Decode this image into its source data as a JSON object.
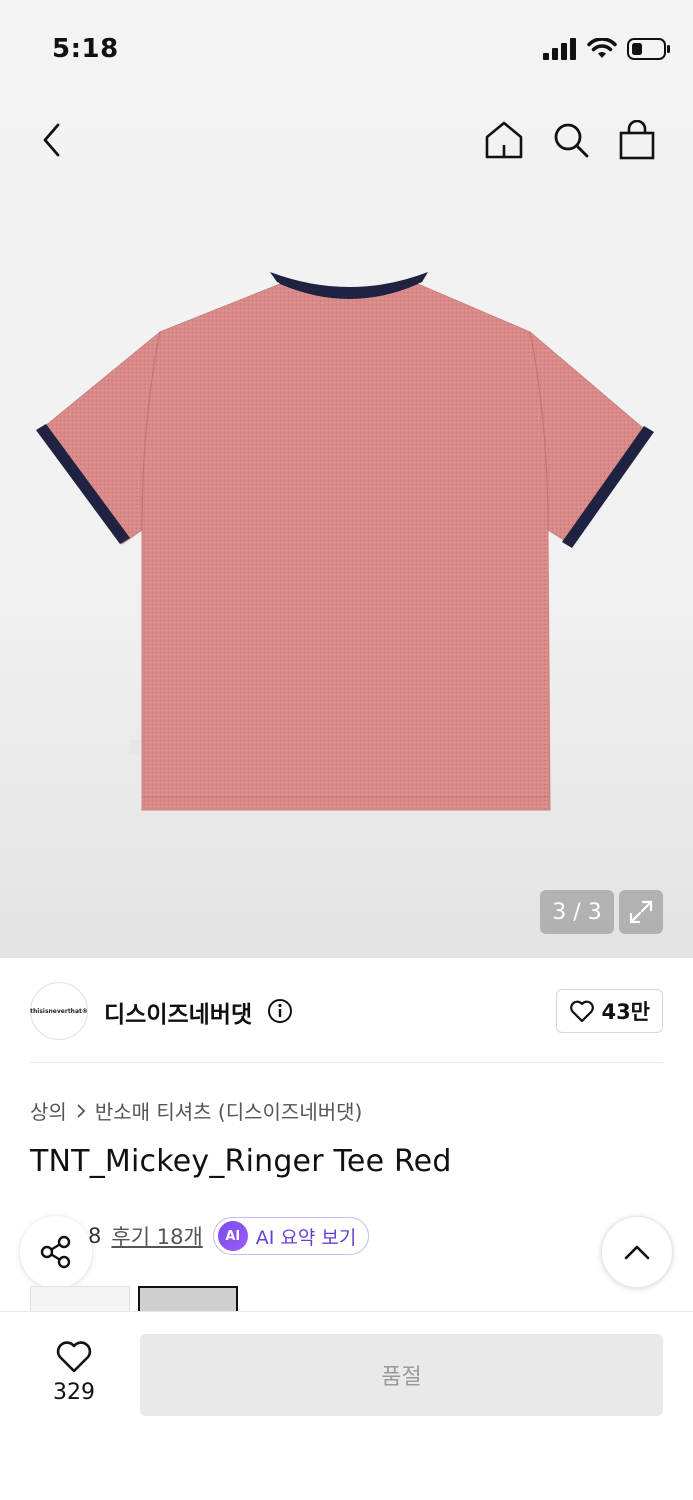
{
  "status_bar": {
    "time": "5:18",
    "icons": [
      "signal-icon",
      "wifi-icon",
      "battery-icon"
    ]
  },
  "nav": {
    "back_icon": "back-icon",
    "home_icon": "home-icon",
    "search_icon": "search-icon",
    "cart_icon": "shopping-bag-icon"
  },
  "gallery": {
    "counter": "3 / 3",
    "expand_icon": "expand-icon",
    "image": "pink-ringer-tee-back"
  },
  "brand": {
    "logo_text": "thisisneverthat®",
    "name": "디스이즈네버댓",
    "likes": "43만"
  },
  "breadcrumb": {
    "category": "상의",
    "subcategory": "반소매 티셔츠 (디스이즈네버댓)"
  },
  "product": {
    "title": "TNT_Mickey_Ringer Tee Red"
  },
  "rating": {
    "score": "4.8",
    "reviews": "후기 18개",
    "ai_badge": "AI",
    "ai_label": "AI 요약 보기"
  },
  "bottom": {
    "wish_count": "329",
    "soldout_label": "품절"
  },
  "colors": {
    "shirt": "#d88a8a",
    "trim": "#1f2240",
    "accent_purple": "#7a4cf0"
  }
}
